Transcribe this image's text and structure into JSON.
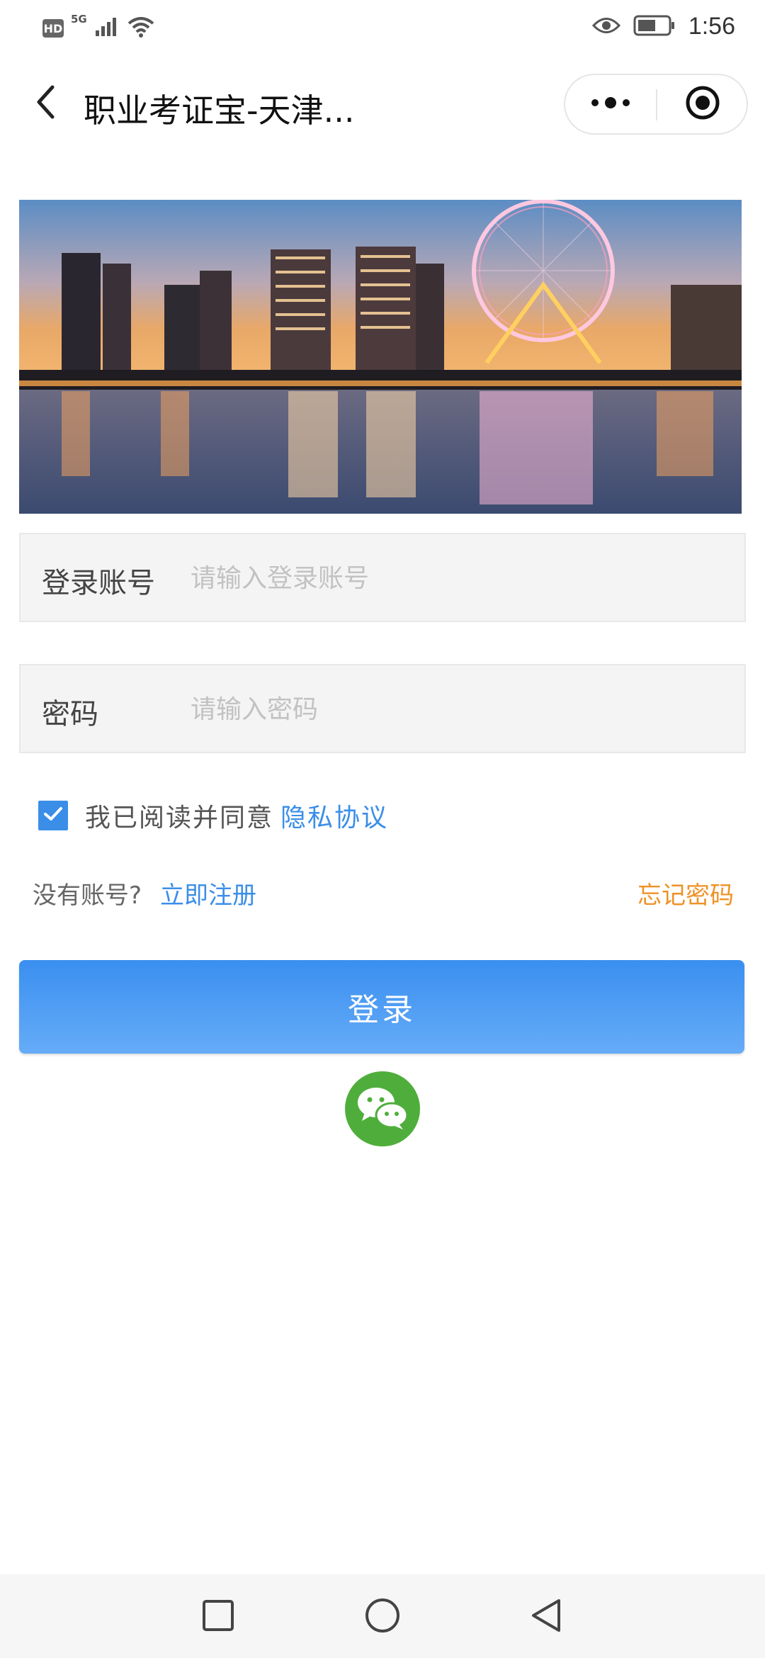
{
  "status_bar": {
    "hd_badge": "HD",
    "network": "5G",
    "time": "1:56"
  },
  "nav": {
    "title": "职业考证宝-天津..."
  },
  "form": {
    "account": {
      "label": "登录账号",
      "placeholder": "请输入登录账号",
      "value": ""
    },
    "password": {
      "label": "密码",
      "placeholder": "请输入密码",
      "value": ""
    },
    "agreement": {
      "checked": true,
      "text": "我已阅读并同意",
      "link": "隐私协议"
    },
    "register": {
      "prompt": "没有账号?",
      "link": "立即注册"
    },
    "forgot": "忘记密码",
    "login_button": "登录"
  },
  "icons": {
    "back": "chevron-left-icon",
    "more": "more-dots-icon",
    "close": "target-circle-icon",
    "wechat": "wechat-icon",
    "checkbox": "check-icon",
    "sys_recent": "square-icon",
    "sys_home": "circle-icon",
    "sys_back": "triangle-back-icon"
  },
  "colors": {
    "accent_blue": "#3b8ee8",
    "forgot_orange": "#ef9126",
    "wechat_green": "#4fae3b"
  }
}
